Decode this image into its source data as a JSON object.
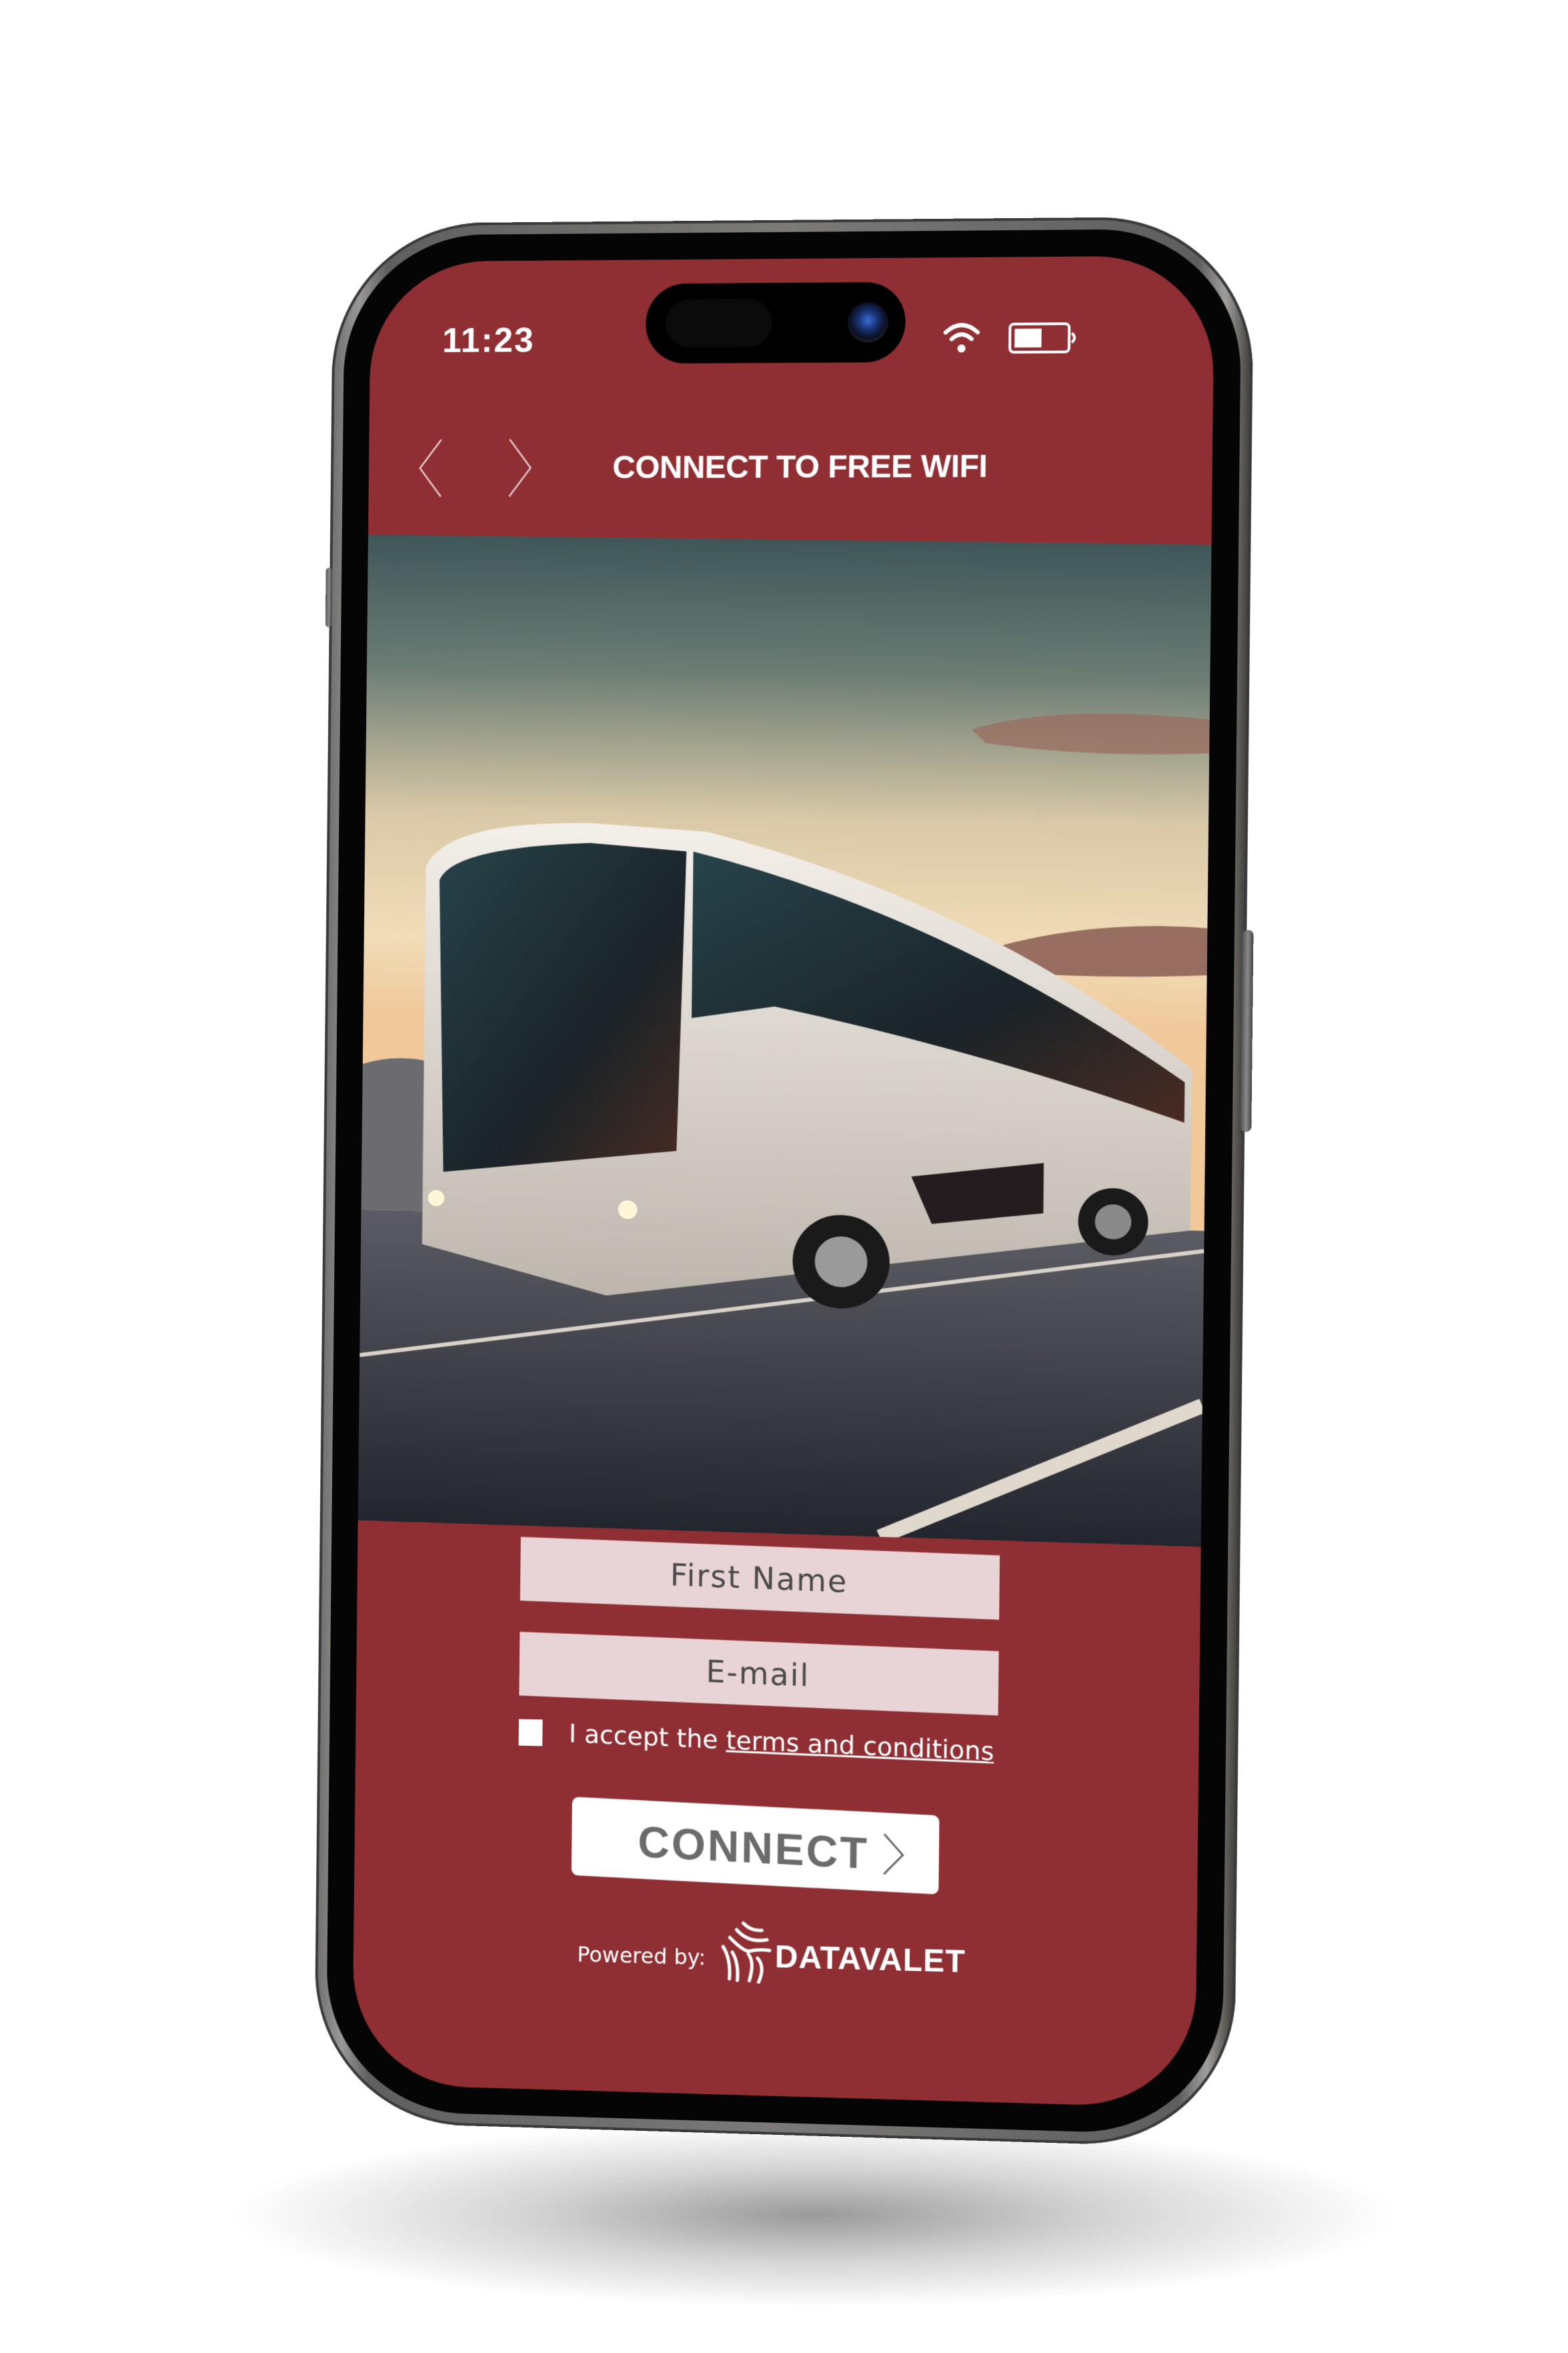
{
  "status_bar": {
    "time": "11:23",
    "wifi_icon": "wifi-icon",
    "battery_icon": "battery-icon",
    "battery_level_percent": 50
  },
  "header": {
    "back_icon": "chevron-left-icon",
    "forward_icon": "chevron-right-icon",
    "title": "CONNECT TO FREE WIFI"
  },
  "hero": {
    "image_description": "White coach bus driving on highway at sunset"
  },
  "form": {
    "first_name": {
      "placeholder": "First Name",
      "value": ""
    },
    "email": {
      "placeholder": "E-mail",
      "value": ""
    },
    "terms": {
      "checked": false,
      "prefix": "I accept the ",
      "link_text": "terms and conditions"
    },
    "connect_button": {
      "label": "CONNECT",
      "icon": "chevron-right-icon"
    }
  },
  "footer": {
    "powered_by_label": "Powered by:",
    "brand_name": "DATAVALET",
    "brand_icon": "datavalet-logo-icon"
  },
  "colors": {
    "brand_primary": "#902f33",
    "input_background": "#e8d4d6",
    "button_background": "#ffffff",
    "button_text": "#6b6b6b",
    "text_on_brand": "#ffffff"
  }
}
